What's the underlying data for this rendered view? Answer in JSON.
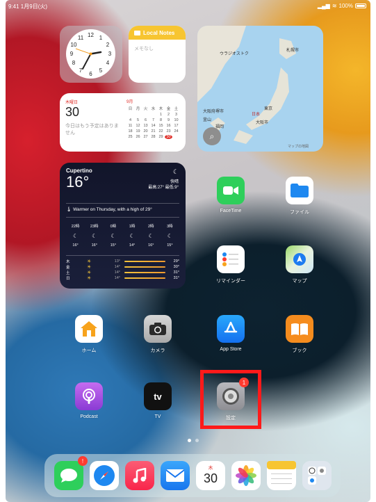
{
  "status_bar": {
    "time": "9:41 1月9日(火)",
    "battery": "100%"
  },
  "notes_widget": {
    "title": "Local Notes",
    "placeholder": "メモなし"
  },
  "map_widget": {
    "labels": [
      "ウラジオストク",
      "札幌市",
      "大阪府堺市",
      "日本",
      "東京",
      "大阪市",
      "釜山",
      "福岡"
    ],
    "credit": "マップの地図"
  },
  "calendar_widget": {
    "weekday": "木曜日",
    "day": "30",
    "note": "今日はもう予定はありません",
    "month": "9月",
    "headers": [
      "日",
      "月",
      "火",
      "水",
      "木",
      "金",
      "土"
    ],
    "days": [
      "",
      "",
      "",
      "",
      "1",
      "2",
      "3",
      "4",
      "5",
      "6",
      "7",
      "8",
      "9",
      "10",
      "11",
      "12",
      "13",
      "14",
      "15",
      "16",
      "17",
      "18",
      "19",
      "20",
      "21",
      "22",
      "23",
      "24",
      "25",
      "26",
      "27",
      "28",
      "29",
      "30"
    ]
  },
  "weather_widget": {
    "city": "Cupertino",
    "temp": "16°",
    "condition": "快晴",
    "hilo": "最高:27° 最低:9°",
    "summary": "Warmer on Thursday, with a high of 29°",
    "hours": [
      {
        "time": "22時",
        "temp": "16°"
      },
      {
        "time": "23時",
        "temp": "16°"
      },
      {
        "time": "0時",
        "temp": "15°"
      },
      {
        "time": "1時",
        "temp": "14°"
      },
      {
        "time": "2時",
        "temp": "16°"
      },
      {
        "time": "3時",
        "temp": "15°"
      }
    ],
    "days": [
      {
        "day": "木",
        "low": "13°",
        "high": "29°"
      },
      {
        "day": "金",
        "low": "14°",
        "high": "30°"
      },
      {
        "day": "土",
        "low": "14°",
        "high": "31°"
      },
      {
        "day": "日",
        "low": "14°",
        "high": "31°"
      }
    ]
  },
  "apps": {
    "facetime": "FaceTime",
    "files": "ファイル",
    "reminders": "リマインダー",
    "maps": "マップ",
    "home": "ホーム",
    "camera": "カメラ",
    "appstore": "App Store",
    "books": "ブック",
    "podcast": "Podcast",
    "tv": "TV",
    "settings": "設定",
    "settings_badge": "1"
  },
  "dock": {
    "messages_badge": "!",
    "calendar_weekday": "木",
    "calendar_day": "30"
  },
  "colors": {
    "highlight": "#ff1a1a",
    "badge": "#ff3b30",
    "notes_accent": "#f7c531"
  }
}
